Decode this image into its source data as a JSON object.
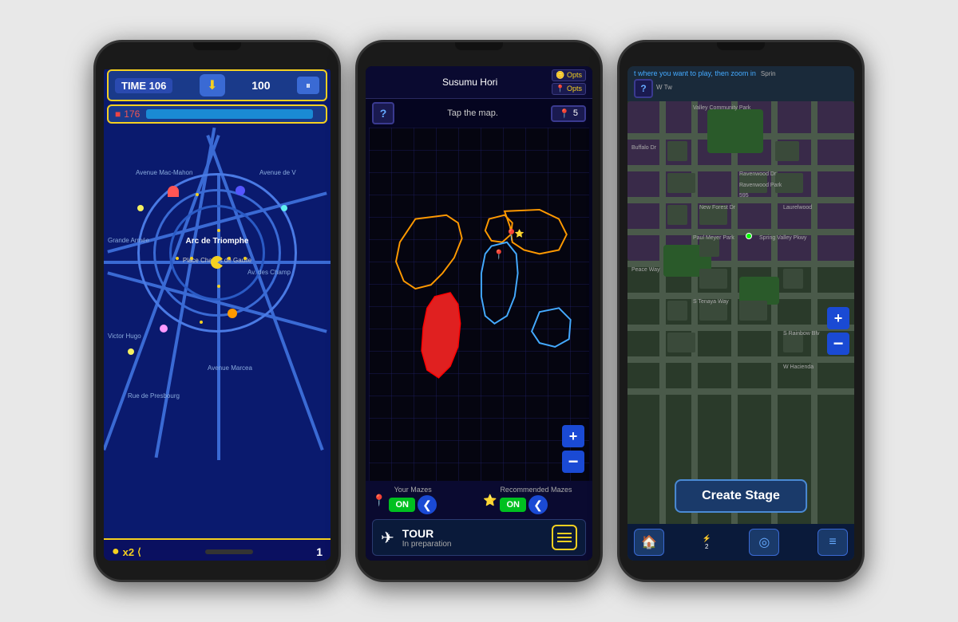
{
  "phone1": {
    "hud": {
      "time_label": "TIME 106",
      "score": "100",
      "lives": "176",
      "pause_icon": "⏸"
    },
    "streets": [
      "Avenue Mac-Mahon",
      "Avenue de V",
      "Arc de Triomphe",
      "Place Charles de Gaulle",
      "Av. des Champ",
      "Grande Armée",
      "Victor Hugo",
      "Avenue Marcea",
      "Rue de Presbourg"
    ],
    "bottom": {
      "lives_label": "x2",
      "score": "1"
    }
  },
  "phone2": {
    "player": "Susumu Hori",
    "opts1": "Opts",
    "opts2": "Opts",
    "help": "?",
    "tap_label": "Tap the map.",
    "pin_count": "5",
    "maze_labels": {
      "your": "Your Mazes",
      "recommended": "Recommended\nMazes"
    },
    "on_label": "ON",
    "tour": {
      "title": "TOUR",
      "subtitle": "In preparation"
    },
    "zoom_plus": "+",
    "zoom_minus": "−"
  },
  "phone3": {
    "header_text": "t where you want to play, then zoom in",
    "help": "?",
    "street_labels": [
      "Valley Community Park",
      "Buffalo Dr",
      "Ravenwood Dr",
      "Ravenwood Park",
      "New Forest Dr",
      "Laurelwood",
      "Paul Meyer Park",
      "Spring Valley Pkwy",
      "Peace Way",
      "S Tenaya Way",
      "S Rainbow Blvd",
      "W Hacienda",
      "Sprin",
      "W Tw"
    ],
    "create_stage": "Create Stage",
    "zoom_plus": "+",
    "zoom_minus": "−",
    "nav": {
      "home": "🏠",
      "radar": "◎",
      "menu": "≡"
    }
  }
}
